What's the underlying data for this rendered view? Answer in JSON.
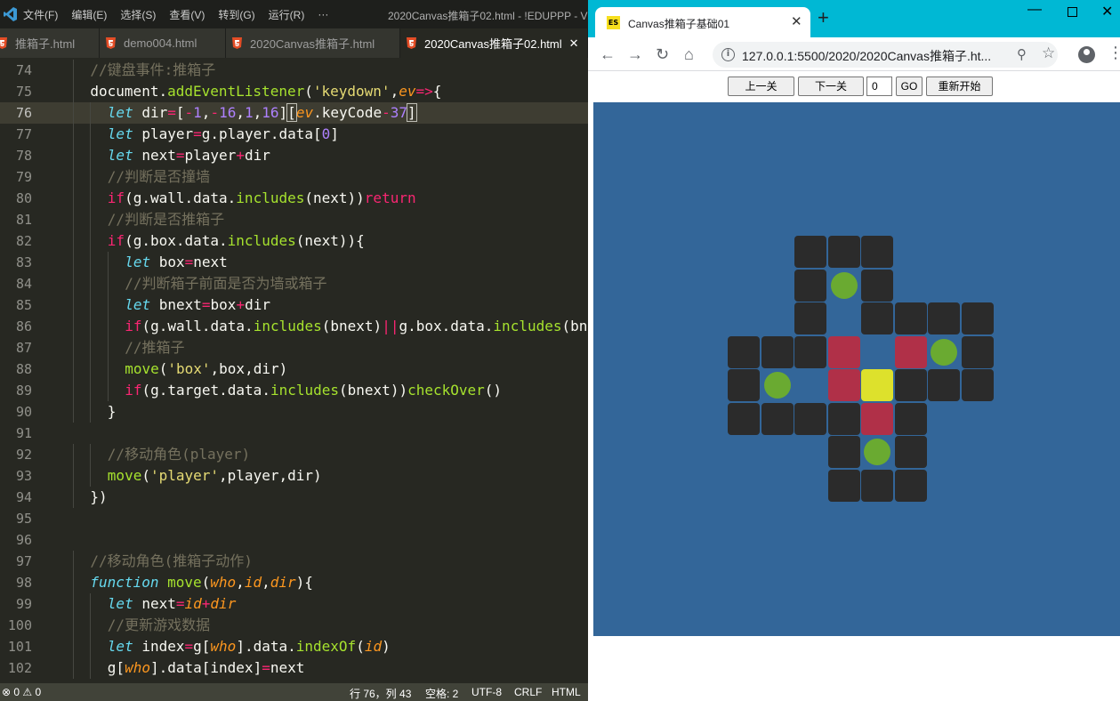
{
  "vscode": {
    "menu": [
      "文件(F)",
      "编辑(E)",
      "选择(S)",
      "查看(V)",
      "转到(G)",
      "运行(R)",
      "···"
    ],
    "window_title": "2020Canvas推箱子02.html - !EDUPPP - Vis",
    "tabs": [
      {
        "label": "推箱子.html",
        "active": false
      },
      {
        "label": "demo004.html",
        "active": false
      },
      {
        "label": "2020Canvas推箱子.html",
        "active": false
      },
      {
        "label": "2020Canvas推箱子02.html",
        "active": true
      }
    ],
    "current_line": 76,
    "lines": [
      {
        "n": "74",
        "indent": 2,
        "tokens": [
          [
            "c",
            "//键盘事件:推箱子"
          ]
        ]
      },
      {
        "n": "75",
        "indent": 2,
        "tokens": [
          [
            "",
            "document."
          ],
          [
            "fn",
            "addEventListener"
          ],
          [
            "",
            "("
          ],
          [
            "s",
            "'keydown'"
          ],
          [
            "",
            ","
          ],
          [
            "p",
            "ev"
          ],
          [
            "op",
            "=>"
          ],
          [
            "",
            "{"
          ]
        ]
      },
      {
        "n": "76",
        "indent": 4,
        "tokens": [
          [
            "k",
            "let"
          ],
          [
            "",
            " dir"
          ],
          [
            "op",
            "="
          ],
          [
            "",
            "["
          ],
          [
            "op",
            "-"
          ],
          [
            "n",
            "1"
          ],
          [
            "",
            ","
          ],
          [
            "op",
            "-"
          ],
          [
            "n",
            "16"
          ],
          [
            "",
            ","
          ],
          [
            "n",
            "1"
          ],
          [
            "",
            ","
          ],
          [
            "n",
            "16"
          ],
          [
            "",
            "]"
          ],
          [
            "bh",
            "["
          ],
          [
            "p",
            "ev"
          ],
          [
            "",
            ".keyCode"
          ],
          [
            "op",
            "-"
          ],
          [
            "n",
            "37"
          ],
          [
            "bh",
            "]"
          ]
        ]
      },
      {
        "n": "77",
        "indent": 4,
        "tokens": [
          [
            "k",
            "let"
          ],
          [
            "",
            " player"
          ],
          [
            "op",
            "="
          ],
          [
            "",
            "g.player.data["
          ],
          [
            "n",
            "0"
          ],
          [
            "",
            "]"
          ]
        ]
      },
      {
        "n": "78",
        "indent": 4,
        "tokens": [
          [
            "k",
            "let"
          ],
          [
            "",
            " next"
          ],
          [
            "op",
            "="
          ],
          [
            "",
            "player"
          ],
          [
            "op",
            "+"
          ],
          [
            "",
            "dir"
          ]
        ]
      },
      {
        "n": "79",
        "indent": 4,
        "tokens": [
          [
            "c",
            "//判断是否撞墙"
          ]
        ]
      },
      {
        "n": "80",
        "indent": 4,
        "tokens": [
          [
            "kw",
            "if"
          ],
          [
            "",
            "(g.wall.data."
          ],
          [
            "fn",
            "includes"
          ],
          [
            "",
            "(next))"
          ],
          [
            "kw",
            "return"
          ]
        ]
      },
      {
        "n": "81",
        "indent": 4,
        "tokens": [
          [
            "c",
            "//判断是否推箱子"
          ]
        ]
      },
      {
        "n": "82",
        "indent": 4,
        "tokens": [
          [
            "kw",
            "if"
          ],
          [
            "",
            "(g.box.data."
          ],
          [
            "fn",
            "includes"
          ],
          [
            "",
            "(next)){"
          ]
        ]
      },
      {
        "n": "83",
        "indent": 6,
        "tokens": [
          [
            "k",
            "let"
          ],
          [
            "",
            " box"
          ],
          [
            "op",
            "="
          ],
          [
            "",
            "next"
          ]
        ]
      },
      {
        "n": "84",
        "indent": 6,
        "tokens": [
          [
            "c",
            "//判断箱子前面是否为墙或箱子"
          ]
        ]
      },
      {
        "n": "85",
        "indent": 6,
        "tokens": [
          [
            "k",
            "let"
          ],
          [
            "",
            " bnext"
          ],
          [
            "op",
            "="
          ],
          [
            "",
            "box"
          ],
          [
            "op",
            "+"
          ],
          [
            "",
            "dir"
          ]
        ]
      },
      {
        "n": "86",
        "indent": 6,
        "tokens": [
          [
            "kw",
            "if"
          ],
          [
            "",
            "(g.wall.data."
          ],
          [
            "fn",
            "includes"
          ],
          [
            "",
            "(bnext)"
          ],
          [
            "op",
            "||"
          ],
          [
            "",
            "g.box.data."
          ],
          [
            "fn",
            "includes"
          ],
          [
            "",
            "(bn"
          ]
        ]
      },
      {
        "n": "87",
        "indent": 6,
        "tokens": [
          [
            "c",
            "//推箱子"
          ]
        ]
      },
      {
        "n": "88",
        "indent": 6,
        "tokens": [
          [
            "fn",
            "move"
          ],
          [
            "",
            "("
          ],
          [
            "s",
            "'box'"
          ],
          [
            "",
            ",box,dir)"
          ]
        ]
      },
      {
        "n": "89",
        "indent": 6,
        "tokens": [
          [
            "kw",
            "if"
          ],
          [
            "",
            "(g.target.data."
          ],
          [
            "fn",
            "includes"
          ],
          [
            "",
            "(bnext))"
          ],
          [
            "fn",
            "checkOver"
          ],
          [
            "",
            "()"
          ]
        ]
      },
      {
        "n": "90",
        "indent": 4,
        "tokens": [
          [
            "",
            "}"
          ]
        ]
      },
      {
        "n": "91",
        "indent": 0,
        "tokens": []
      },
      {
        "n": "92",
        "indent": 4,
        "tokens": [
          [
            "c",
            "//移动角色(player)"
          ]
        ]
      },
      {
        "n": "93",
        "indent": 4,
        "tokens": [
          [
            "fn",
            "move"
          ],
          [
            "",
            "("
          ],
          [
            "s",
            "'player'"
          ],
          [
            "",
            ",player,dir)"
          ]
        ]
      },
      {
        "n": "94",
        "indent": 2,
        "tokens": [
          [
            "",
            "})"
          ]
        ]
      },
      {
        "n": "95",
        "indent": 0,
        "tokens": []
      },
      {
        "n": "96",
        "indent": 0,
        "tokens": []
      },
      {
        "n": "97",
        "indent": 2,
        "tokens": [
          [
            "c",
            "//移动角色(推箱子动作)"
          ]
        ]
      },
      {
        "n": "98",
        "indent": 2,
        "tokens": [
          [
            "k",
            "function"
          ],
          [
            "",
            " "
          ],
          [
            "fn",
            "move"
          ],
          [
            "",
            "("
          ],
          [
            "p",
            "who"
          ],
          [
            "",
            ","
          ],
          [
            "p",
            "id"
          ],
          [
            "",
            ","
          ],
          [
            "p",
            "dir"
          ],
          [
            "",
            "){"
          ]
        ]
      },
      {
        "n": "99",
        "indent": 4,
        "tokens": [
          [
            "k",
            "let"
          ],
          [
            "",
            " next"
          ],
          [
            "op",
            "="
          ],
          [
            "p",
            "id"
          ],
          [
            "op",
            "+"
          ],
          [
            "p",
            "dir"
          ]
        ]
      },
      {
        "n": "100",
        "indent": 4,
        "tokens": [
          [
            "c",
            "//更新游戏数据"
          ]
        ]
      },
      {
        "n": "101",
        "indent": 4,
        "tokens": [
          [
            "k",
            "let"
          ],
          [
            "",
            " index"
          ],
          [
            "op",
            "="
          ],
          [
            "",
            "g["
          ],
          [
            "p",
            "who"
          ],
          [
            "",
            "].data."
          ],
          [
            "fn",
            "indexOf"
          ],
          [
            "",
            "("
          ],
          [
            "p",
            "id"
          ],
          [
            "",
            ")"
          ]
        ]
      },
      {
        "n": "102",
        "indent": 4,
        "tokens": [
          [
            "",
            "g["
          ],
          [
            "p",
            "who"
          ],
          [
            "",
            "].data[index]"
          ],
          [
            "op",
            "="
          ],
          [
            "",
            "next"
          ]
        ]
      }
    ],
    "status": {
      "problems": "⊗ 0 ⚠ 0",
      "position": "行 76，列 43",
      "spaces": "空格: 2",
      "encoding": "UTF-8",
      "eol": "CRLF",
      "language": "HTML"
    }
  },
  "browser": {
    "favicon": "ES",
    "tab_title": "Canvas推箱子基础01",
    "new_tab": "+",
    "url": "127.0.0.1:5500/2020/2020Canvas推箱子.ht...",
    "buttons": {
      "prev": "上一关",
      "next": "下一关",
      "level_value": "0",
      "go": "GO",
      "restart": "重新开始"
    },
    "colors": {
      "background": "#336699",
      "wall": "#2b2b2b",
      "box": "#b03048",
      "player": "#dde12c",
      "target": "#6aaa31"
    },
    "board": {
      "walls": [
        [
          2,
          0
        ],
        [
          3,
          0
        ],
        [
          4,
          0
        ],
        [
          2,
          1
        ],
        [
          4,
          1
        ],
        [
          2,
          2
        ],
        [
          4,
          2
        ],
        [
          5,
          2
        ],
        [
          6,
          2
        ],
        [
          7,
          2
        ],
        [
          0,
          3
        ],
        [
          1,
          3
        ],
        [
          2,
          3
        ],
        [
          7,
          3
        ],
        [
          0,
          4
        ],
        [
          5,
          4
        ],
        [
          6,
          4
        ],
        [
          7,
          4
        ],
        [
          0,
          5
        ],
        [
          1,
          5
        ],
        [
          2,
          5
        ],
        [
          3,
          5
        ],
        [
          5,
          5
        ],
        [
          3,
          6
        ],
        [
          5,
          6
        ],
        [
          3,
          7
        ],
        [
          4,
          7
        ],
        [
          5,
          7
        ]
      ],
      "boxes": [
        [
          3,
          3
        ],
        [
          5,
          3
        ],
        [
          3,
          4
        ],
        [
          4,
          5
        ]
      ],
      "targets": [
        [
          3,
          1
        ],
        [
          6,
          3
        ],
        [
          1,
          4
        ],
        [
          4,
          6
        ]
      ],
      "player": [
        4,
        4
      ]
    }
  }
}
